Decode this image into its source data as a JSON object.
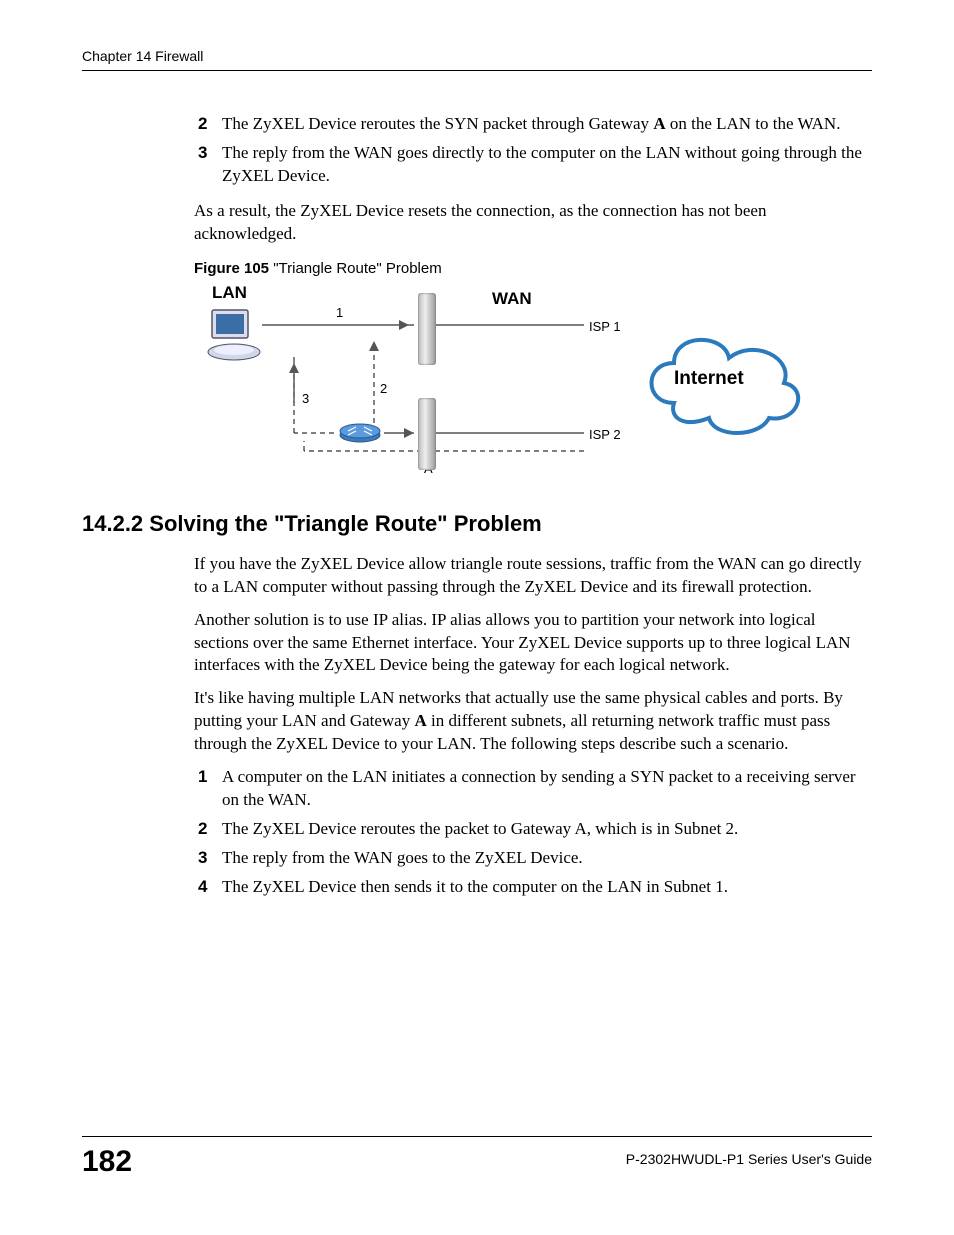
{
  "header": {
    "chapter": "Chapter 14 Firewall"
  },
  "list1": {
    "item2_num": "2",
    "item2": "The ZyXEL Device reroutes the SYN packet through Gateway A on the LAN to the WAN.",
    "item3_num": "3",
    "item3": "The reply from the WAN goes directly to the computer on the LAN without going through the ZyXEL Device."
  },
  "para1": "As a result, the ZyXEL Device resets the connection, as the connection has not been acknowledged.",
  "figure": {
    "caption_label": "Figure 105",
    "caption_text": "   \"Triangle Route\" Problem",
    "lan": "LAN",
    "wan": "WAN",
    "isp1": "ISP 1",
    "isp2": "ISP 2",
    "num1": "1",
    "num2": "2",
    "num3": "3",
    "a": "A",
    "internet": "Internet"
  },
  "heading": "14.2.2  Solving the \"Triangle Route\" Problem",
  "para2": "If you have the ZyXEL Device allow triangle route sessions, traffic from the WAN can go directly to a LAN computer without passing through the ZyXEL Device and its firewall protection.",
  "para3": "Another solution is to use IP alias. IP alias allows you to partition your network into logical sections over the same Ethernet interface. Your ZyXEL Device supports up to three logical LAN interfaces with the ZyXEL Device being the gateway for each logical network.",
  "para4": "It's like having multiple LAN networks that actually use the same physical cables and ports. By putting your LAN and Gateway A in different subnets, all returning network traffic must pass through the ZyXEL Device to your LAN. The following steps describe such a scenario.",
  "list2": {
    "n1": "1",
    "t1": "A computer on the LAN initiates a connection by sending a SYN packet to a receiving server on the WAN.",
    "n2": "2",
    "t2": "The ZyXEL Device reroutes the packet to Gateway A, which is in Subnet 2.",
    "n3": "3",
    "t3": "The reply from the WAN goes to the ZyXEL Device.",
    "n4": "4",
    "t4": "The ZyXEL Device then sends it to the computer on the LAN in Subnet 1."
  },
  "footer": {
    "page": "182",
    "guide": "P-2302HWUDL-P1 Series User's Guide"
  }
}
